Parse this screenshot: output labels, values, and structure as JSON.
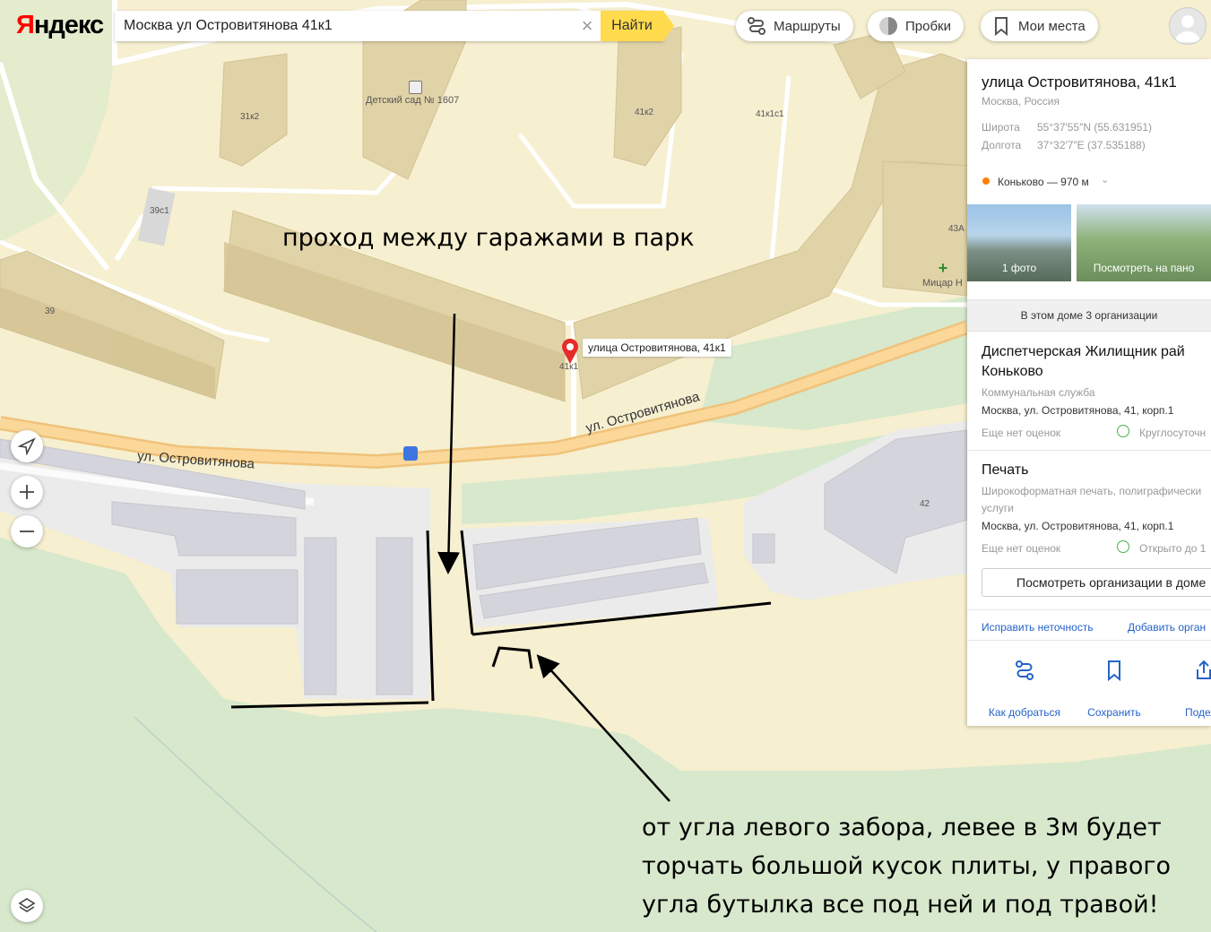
{
  "header": {
    "logo": "Яндекс",
    "search_value": "Москва ул Островитянова 41к1",
    "search_button": "Найти",
    "routes": "Маршруты",
    "traffic": "Пробки",
    "my_places": "Мои места"
  },
  "map": {
    "buildings": {
      "b31k2": "31к2",
      "b39c1": "39с1",
      "b39": "39",
      "b41k2": "41к2",
      "b41k1c1": "41к1с1",
      "b43a": "43А",
      "b42": "42",
      "b41k1": "41к1"
    },
    "poi_kindergarten": "Детский сад № 1607",
    "poi_clinic": "Мицар Н",
    "street_label": "ул. Островитянова",
    "pin_label": "улица Островитянова, 41к1"
  },
  "annotations": {
    "top": "проход между гаражами в парк",
    "bottom_line1": "от угла левого забора, левее в 3м будет",
    "bottom_line2": "торчать большой кусок плиты, у правого",
    "bottom_line3": "угла бутылка все под ней и под травой!"
  },
  "panel": {
    "title": "улица Островитянова, 41к1",
    "subtitle": "Москва, Россия",
    "lat_label": "Широта",
    "lat_value": "55°37′55″N (55.631951)",
    "lon_label": "Долгота",
    "lon_value": "37°32′7″E (37.535188)",
    "metro": "Коньково — 970 м",
    "metro_color": "#ff7f00",
    "photo1_caption": "1 фото",
    "photo2_caption": "Посмотреть на пано",
    "orgs_count": "В этом доме 3 организации",
    "org1": {
      "name_line1": "Диспетчерская Жилищник рай",
      "name_line2": "Коньково",
      "category": "Коммунальная служба",
      "address": "Москва, ул. Островитянова, 41, корп.1",
      "rating": "Еще нет оценок",
      "hours": "Круглосуточн"
    },
    "org2": {
      "name": "Печать",
      "category_line1": "Широкоформатная печать, полиграфически",
      "category_line2": "услуги",
      "address": "Москва, ул. Островитянова, 41, корп.1",
      "rating": "Еще нет оценок",
      "hours": "Открыто до 1"
    },
    "view_orgs": "Посмотреть организации в доме",
    "fix_link": "Исправить неточность",
    "add_link": "Добавить орган",
    "action_route": "Как добраться",
    "action_save": "Сохранить",
    "action_share": "Подели"
  }
}
